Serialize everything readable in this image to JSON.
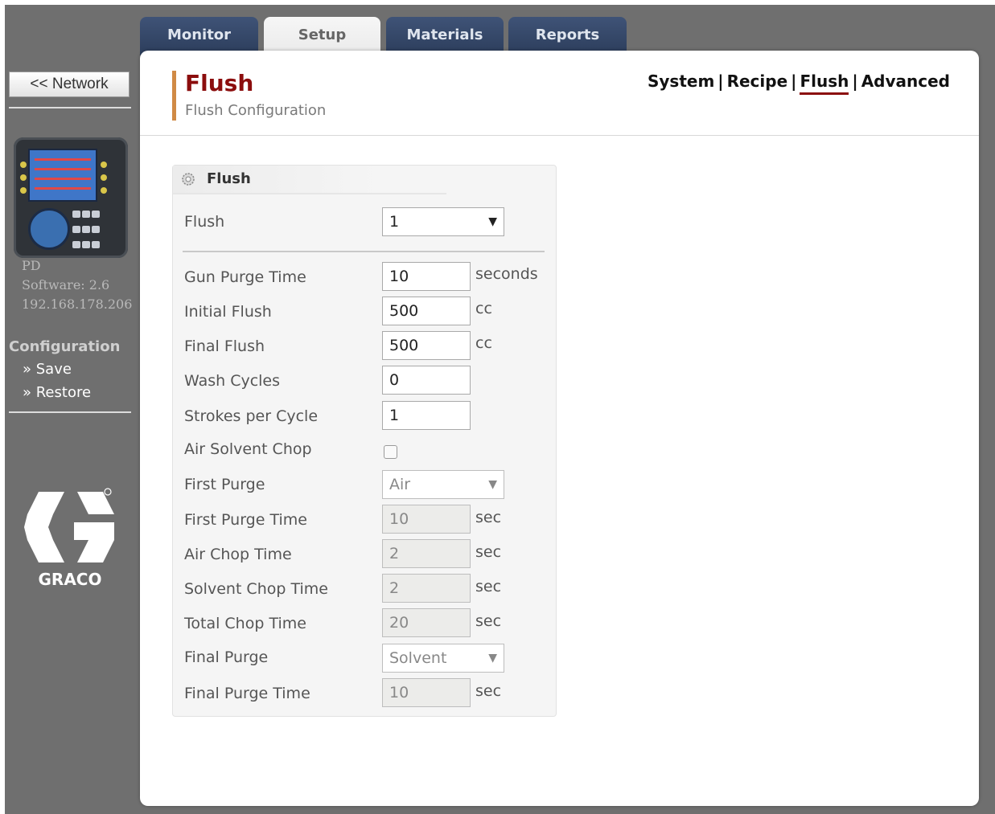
{
  "tabs": [
    {
      "label": "Monitor"
    },
    {
      "label": "Setup"
    },
    {
      "label": "Materials"
    },
    {
      "label": "Reports"
    }
  ],
  "sidebar": {
    "network_button": "<< Network",
    "device_name": "PD",
    "software": "Software: 2.6",
    "ip": "192.168.178.206",
    "configuration_title": "Configuration",
    "links": [
      {
        "label": "» Save"
      },
      {
        "label": "» Restore"
      }
    ],
    "logo_text": "GRACO"
  },
  "header": {
    "title": "Flush",
    "subtitle": "Flush Configuration",
    "subnav": [
      {
        "label": "System"
      },
      {
        "label": "Recipe"
      },
      {
        "label": "Flush"
      },
      {
        "label": "Advanced"
      }
    ],
    "subnav_separator": "|"
  },
  "flush_box": {
    "title": "Flush",
    "flush_select": {
      "label": "Flush",
      "value": "1"
    },
    "rows": [
      {
        "label": "Gun Purge Time",
        "value": "10",
        "unit": "seconds"
      },
      {
        "label": "Initial Flush",
        "value": "500",
        "unit": "cc"
      },
      {
        "label": "Final Flush",
        "value": "500",
        "unit": "cc"
      },
      {
        "label": "Wash Cycles",
        "value": "0"
      },
      {
        "label": "Strokes per Cycle",
        "value": "1"
      },
      {
        "label": "Air Solvent Chop"
      },
      {
        "label": "First Purge",
        "value": "Air"
      },
      {
        "label": "First Purge Time",
        "value": "10",
        "unit": "sec"
      },
      {
        "label": "Air Chop Time",
        "value": "2",
        "unit": "sec"
      },
      {
        "label": "Solvent Chop Time",
        "value": "2",
        "unit": "sec"
      },
      {
        "label": "Total Chop Time",
        "value": "20",
        "unit": "sec"
      },
      {
        "label": "Final Purge",
        "value": "Solvent"
      },
      {
        "label": "Final Purge Time",
        "value": "10",
        "unit": "sec"
      }
    ]
  },
  "colors": {
    "tab_bg": "#34476a",
    "title_red": "#8b0d0d",
    "accent_orange": "#d08a45",
    "sidebar_bg": "#6f6f6f"
  }
}
